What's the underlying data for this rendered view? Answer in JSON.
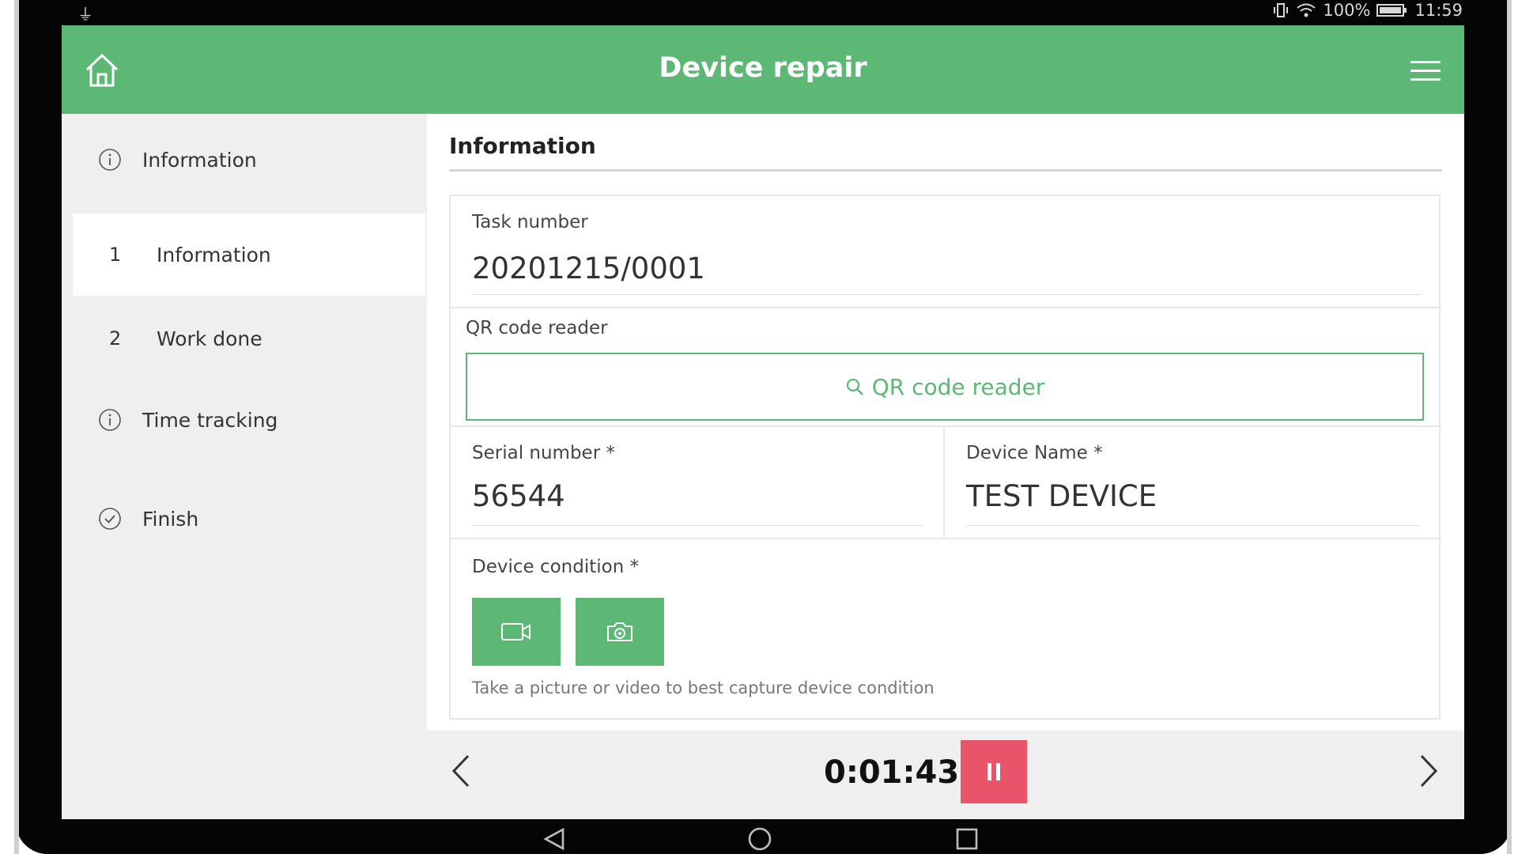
{
  "status_bar": {
    "battery_percent": "100%",
    "time": "11:59"
  },
  "app_bar": {
    "title": "Device repair",
    "home_icon": "home-icon",
    "menu_icon": "hamburger-menu-icon"
  },
  "sidebar": {
    "items": [
      {
        "icon": "info-icon",
        "label": "Information"
      },
      {
        "number": "1",
        "label": "Information",
        "active": true
      },
      {
        "number": "2",
        "label": "Work done"
      },
      {
        "icon": "info-icon",
        "label": "Time tracking"
      },
      {
        "icon": "check-circle-icon",
        "label": "Finish"
      }
    ]
  },
  "content": {
    "section_title": "Information",
    "task_number": {
      "label": "Task number",
      "value": "20201215/0001"
    },
    "qr_reader": {
      "label": "QR code reader",
      "button_label": "QR code reader",
      "icon": "search-icon"
    },
    "serial_number": {
      "label": "Serial number *",
      "value": "56544"
    },
    "device_name": {
      "label": "Device Name *",
      "value": "TEST DEVICE"
    },
    "device_condition": {
      "label": "Device condition *",
      "video_icon": "video-camera-icon",
      "photo_icon": "camera-icon",
      "hint": "Take a picture or video to best capture device condition"
    }
  },
  "bottom_bar": {
    "timer": "0:01:43",
    "prev_icon": "chevron-left-icon",
    "next_icon": "chevron-right-icon",
    "pause_icon": "pause-icon"
  },
  "colors": {
    "accent_green": "#5cb874",
    "pause_red": "#e9546b",
    "sidebar_bg": "#efefef"
  }
}
